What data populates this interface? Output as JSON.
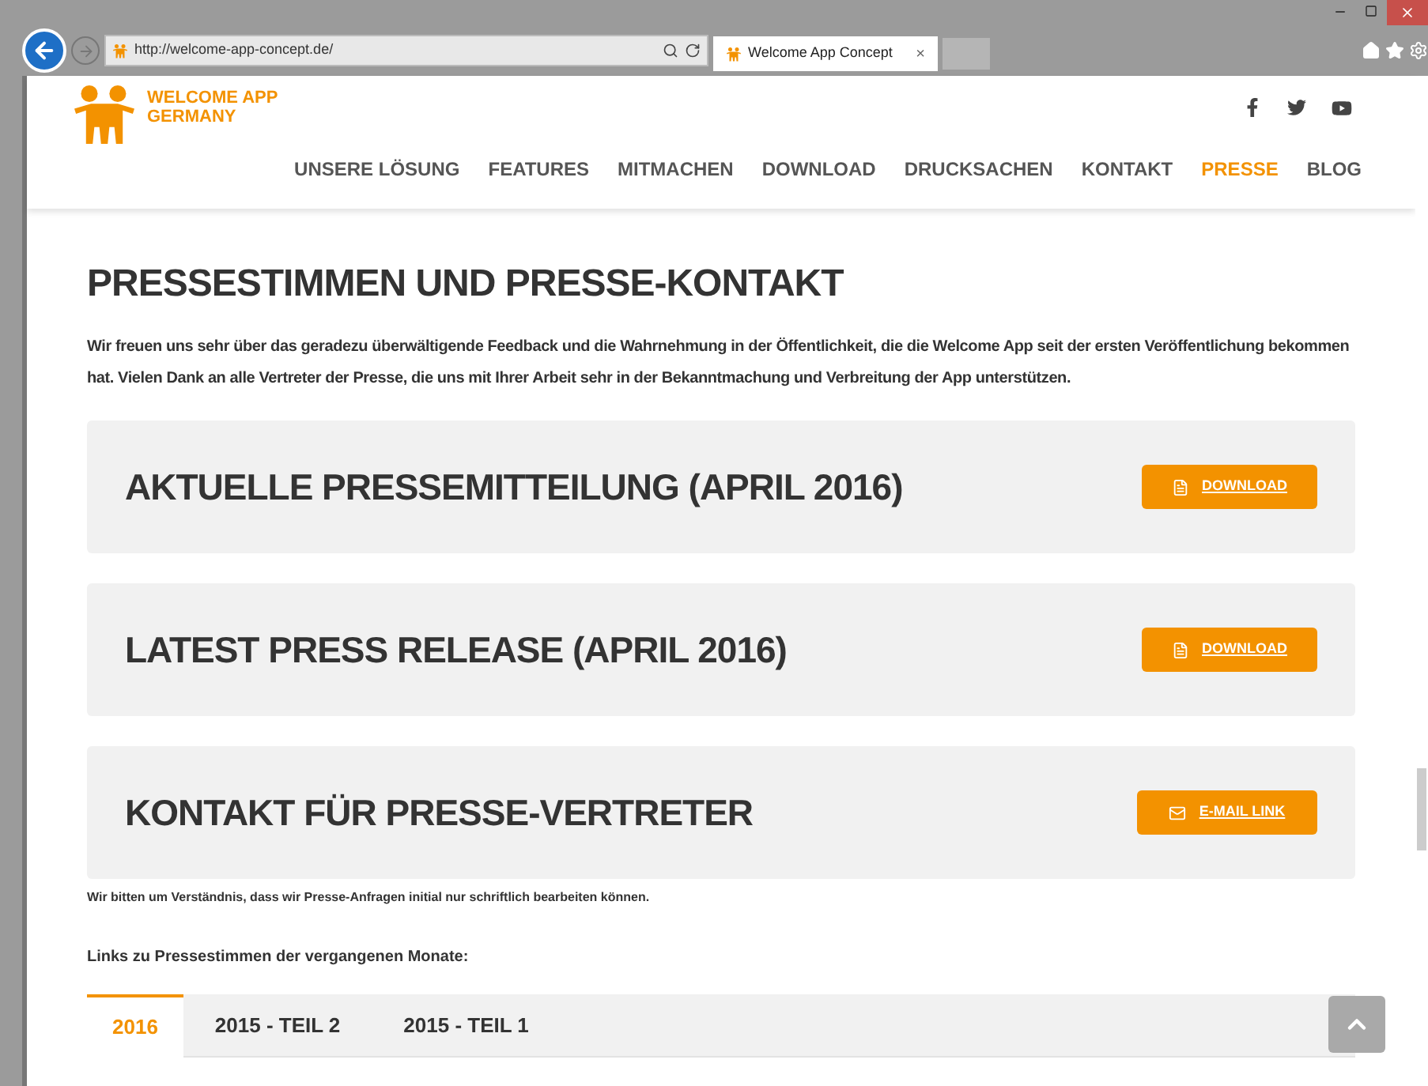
{
  "browser": {
    "url": "http://welcome-app-concept.de/",
    "tab_title": "Welcome App Concept",
    "tab_close": "×"
  },
  "site": {
    "logo_lines": [
      "WELCOME APP",
      "GERMANY"
    ],
    "nav": [
      {
        "label": "UNSERE LÖSUNG",
        "selected": false
      },
      {
        "label": "FEATURES",
        "selected": false
      },
      {
        "label": "MITMACHEN",
        "selected": false
      },
      {
        "label": "DOWNLOAD",
        "selected": false
      },
      {
        "label": "DRUCKSACHEN",
        "selected": false
      },
      {
        "label": "KONTAKT",
        "selected": false
      },
      {
        "label": "PRESSE",
        "selected": true
      },
      {
        "label": "BLOG",
        "selected": false
      }
    ]
  },
  "page": {
    "heading": "PRESSESTIMMEN UND PRESSE-KONTAKT",
    "intro": "Wir freuen uns sehr über das geradezu überwältigende Feedback und die Wahrnehmung in der Öffentlichkeit, die die Welcome App seit der ersten Veröffentlichung bekommen hat. Vielen Dank an alle Vertreter der Presse, die uns mit Ihrer Arbeit sehr in der Bekanntmachung und Verbreitung der App unterstützen.",
    "cards": [
      {
        "title": "AKTUELLE PRESSEMITTEILUNG (APRIL 2016)",
        "button": {
          "label": "DOWNLOAD",
          "kind": "pdf"
        }
      },
      {
        "title": "LATEST PRESS RELEASE (APRIL 2016)",
        "button": {
          "label": "DOWNLOAD",
          "kind": "pdf"
        }
      },
      {
        "title": "KONTAKT FÜR PRESSE-VERTRETER",
        "button": {
          "label": "E-MAIL LINK",
          "kind": "mail"
        }
      }
    ],
    "note": "Wir bitten um Verständnis, dass wir Presse-Anfragen initial nur schriftlich bearbeiten können.",
    "links_heading": "Links zu Pressestimmen der vergangenen Monate:",
    "tabs": [
      {
        "label": "2016",
        "selected": true
      },
      {
        "label": "2015 - TEIL 2",
        "selected": false
      },
      {
        "label": "2015 - TEIL 1",
        "selected": false
      }
    ]
  }
}
